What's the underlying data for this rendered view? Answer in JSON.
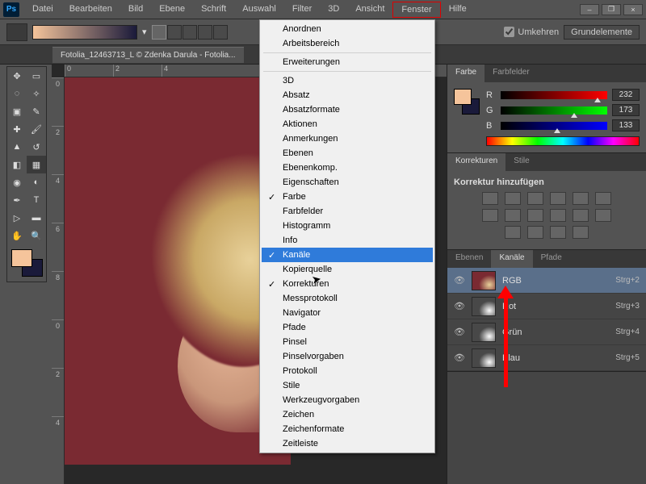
{
  "menubar": [
    "Datei",
    "Bearbeiten",
    "Bild",
    "Ebene",
    "Schrift",
    "Auswahl",
    "Filter",
    "3D",
    "Ansicht",
    "Fenster",
    "Hilfe"
  ],
  "active_menu_index": 9,
  "options": {
    "umkehren": "Umkehren",
    "grundelemente": "Grundelemente"
  },
  "doc_tab": "Fotolia_12463713_L © Zdenka Darula - Fotolia...",
  "dropdown": {
    "groups": [
      [
        "Anordnen",
        "Arbeitsbereich"
      ],
      [
        "Erweiterungen"
      ],
      [
        "3D",
        "Absatz",
        "Absatzformate",
        "Aktionen",
        "Anmerkungen",
        "Ebenen",
        "Ebenenkomp.",
        "Eigenschaften",
        "Farbe",
        "Farbfelder",
        "Histogramm",
        "Info",
        "Kanäle",
        "Kopierquelle",
        "Korrekturen",
        "Messprotokoll",
        "Navigator",
        "Pfade",
        "Pinsel",
        "Pinselvorgaben",
        "Protokoll",
        "Stile",
        "Werkzeugvorgaben",
        "Zeichen",
        "Zeichenformate",
        "Zeitleiste"
      ]
    ],
    "checked": [
      "Farbe",
      "Kanäle",
      "Korrekturen"
    ],
    "highlighted": "Kanäle"
  },
  "panels": {
    "color": {
      "tabs": [
        "Farbe",
        "Farbfelder"
      ],
      "active": 0,
      "r": 232,
      "g": 173,
      "b": 133
    },
    "adjustments": {
      "tabs": [
        "Korrekturen",
        "Stile"
      ],
      "active": 0,
      "title": "Korrektur hinzufügen"
    },
    "channels": {
      "tabs": [
        "Ebenen",
        "Kanäle",
        "Pfade"
      ],
      "active": 1,
      "rows": [
        {
          "name": "RGB",
          "shortcut": "Strg+2",
          "sel": true
        },
        {
          "name": "Rot",
          "shortcut": "Strg+3"
        },
        {
          "name": "Grün",
          "shortcut": "Strg+4"
        },
        {
          "name": "Blau",
          "shortcut": "Strg+5"
        }
      ]
    }
  },
  "ruler_h": [
    "0",
    "2",
    "4"
  ],
  "ruler_v": [
    "0",
    "2",
    "4",
    "6",
    "8",
    "0",
    "2",
    "4"
  ]
}
